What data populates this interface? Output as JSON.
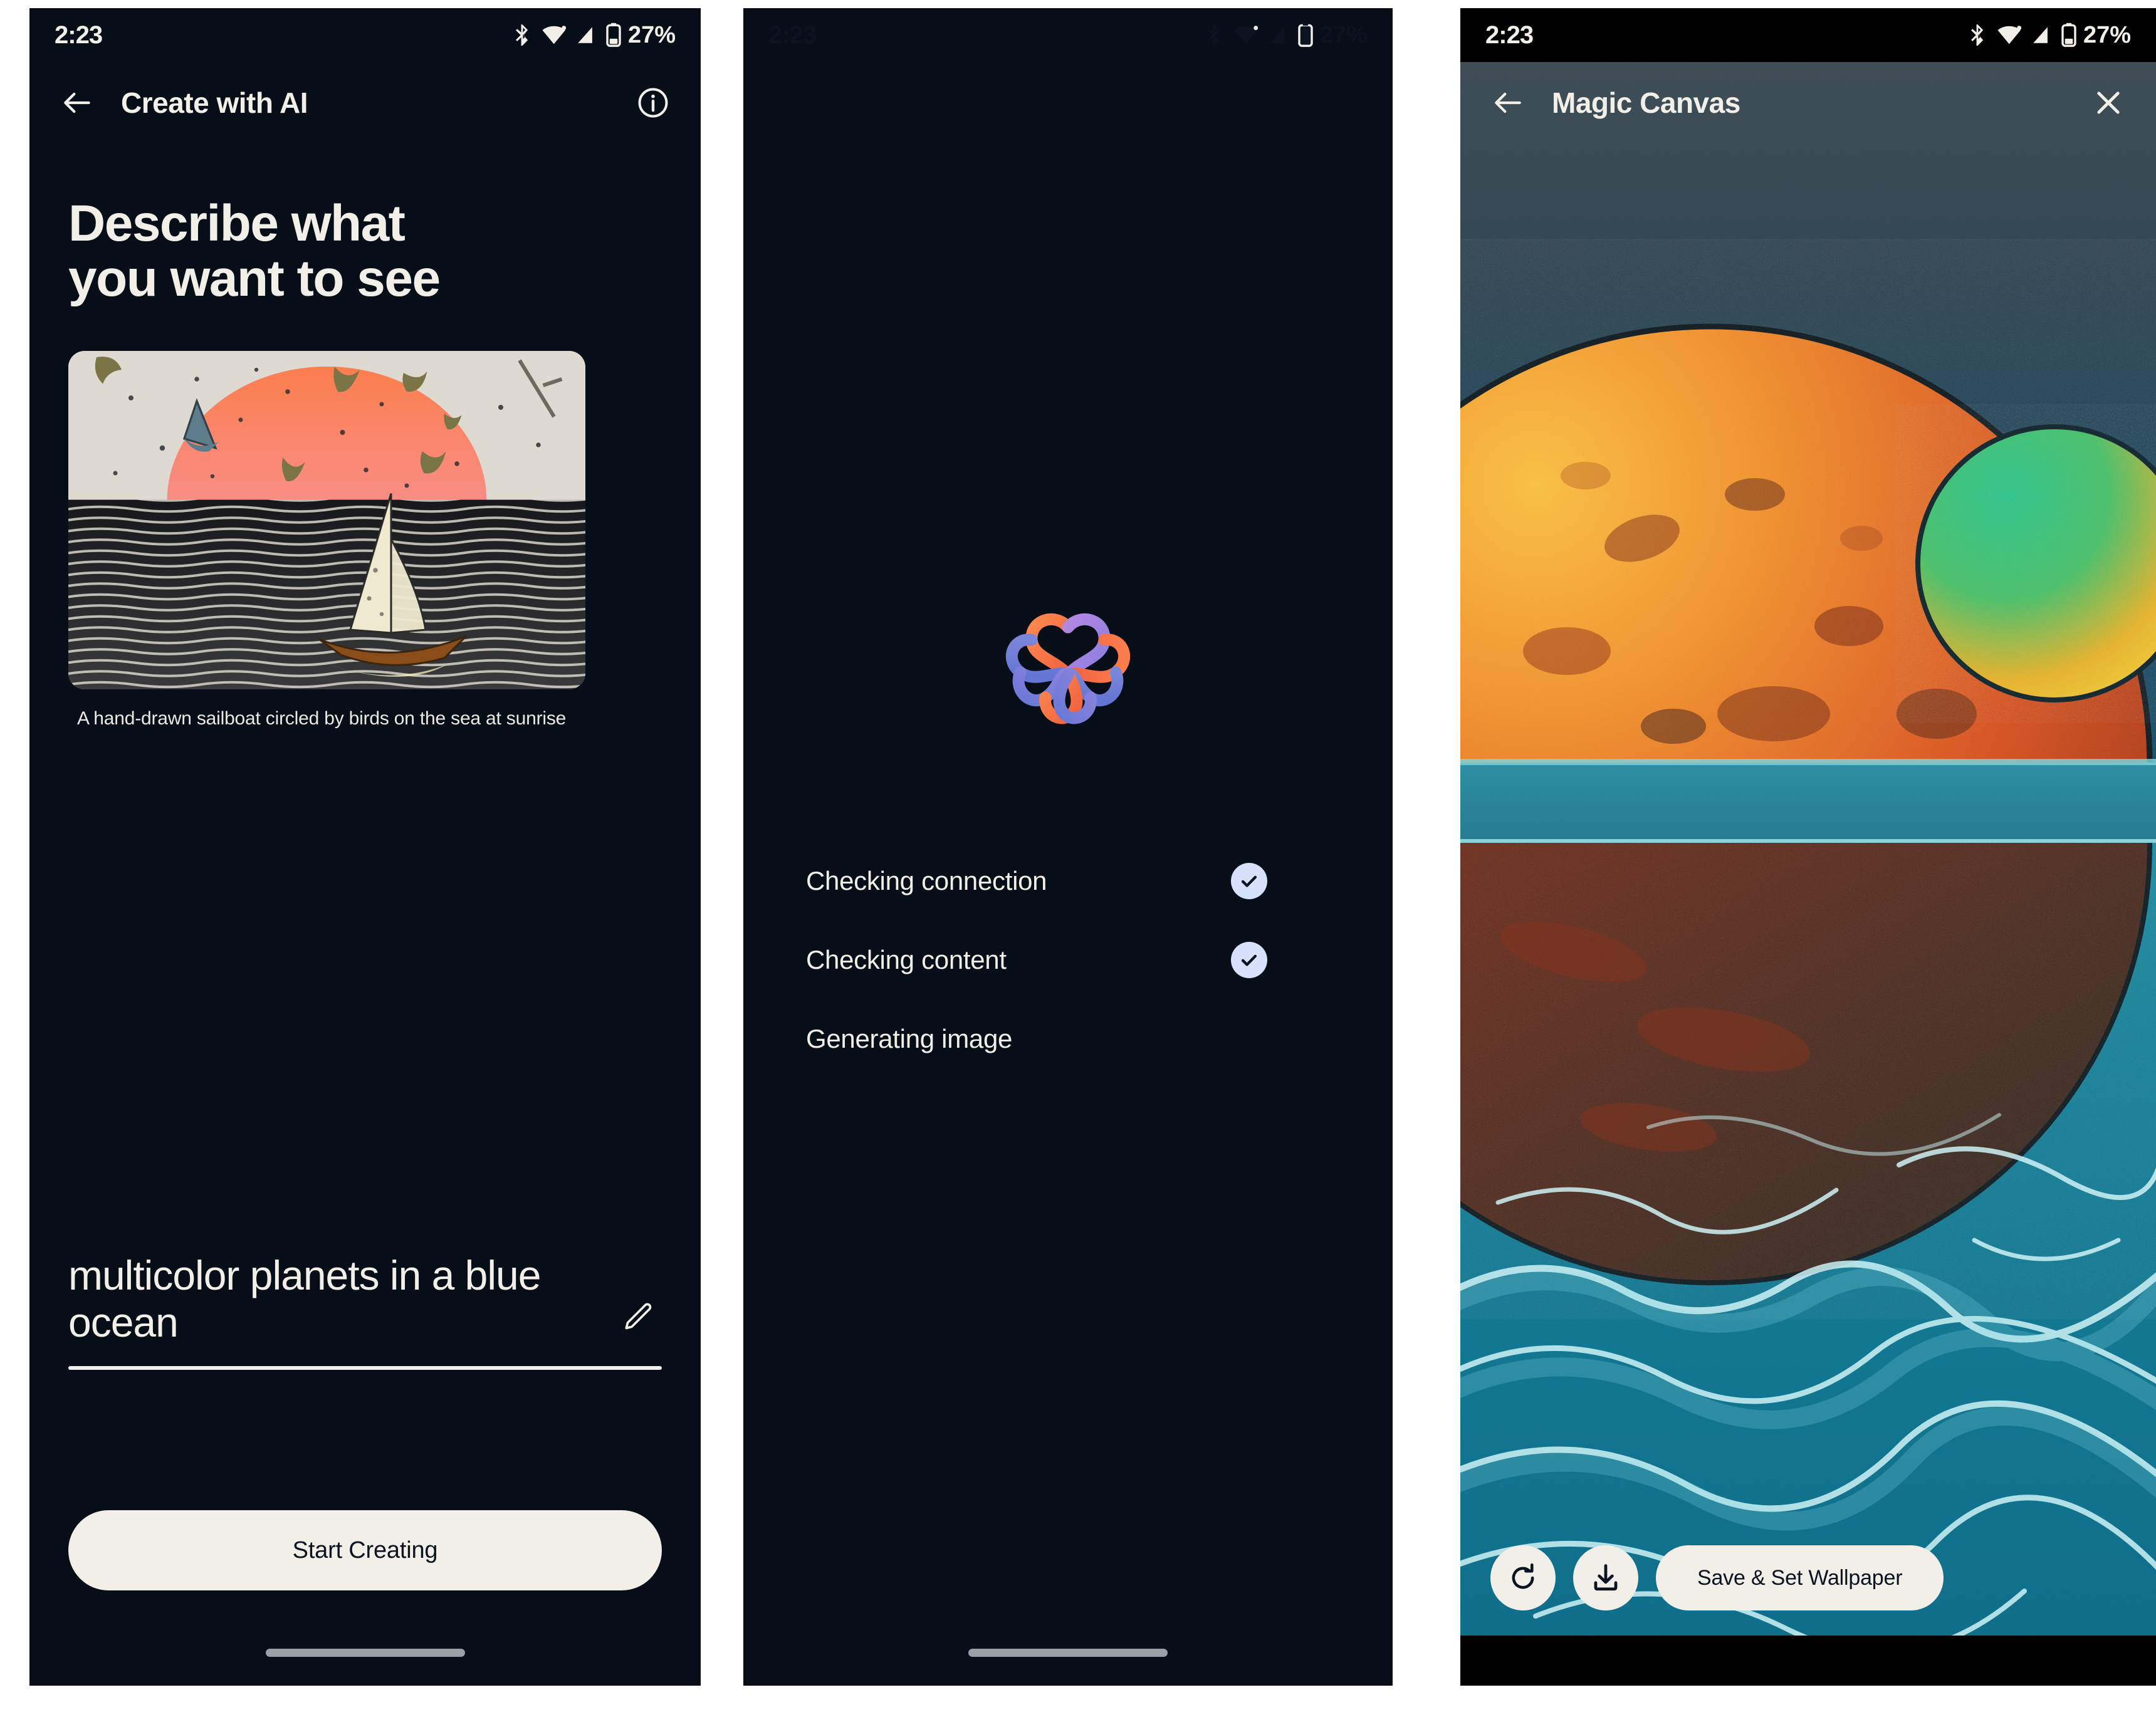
{
  "status_bar": {
    "time": "2:23",
    "battery": "27%",
    "icons": [
      "bluetooth-icon",
      "wifi-icon",
      "cellular-signal-icon",
      "battery-icon"
    ]
  },
  "panel1": {
    "app_bar": {
      "back_label": "back-arrow-icon",
      "title": "Create with AI",
      "info_label": "info-icon"
    },
    "headline_line1": "Describe what",
    "headline_line2": "you want to see",
    "example_caption": "A hand-drawn sailboat circled by birds on the sea at sunrise",
    "prompt_value": "multicolor planets in a blue ocean",
    "edit_icon": "pencil-icon",
    "cta_label": "Start Creating"
  },
  "panel2": {
    "logo": "magic-canvas-knot-logo",
    "steps": [
      {
        "label": "Checking connection",
        "done": true
      },
      {
        "label": "Checking content",
        "done": true
      },
      {
        "label": "Generating image",
        "done": false
      }
    ]
  },
  "panel3": {
    "app_bar": {
      "back_label": "back-arrow-icon",
      "title": "Magic Canvas",
      "close_label": "close-icon"
    },
    "actions": {
      "regenerate_icon": "refresh-icon",
      "download_icon": "download-icon",
      "save_label": "Save & Set Wallpaper"
    }
  },
  "colors": {
    "panel_background": "#070e18",
    "on_surface": "#f2efe9",
    "accent_check": "#d6e2fb",
    "logo_orange": "#f97c4a",
    "logo_purple": "#a97fd6",
    "logo_blue": "#6b79d6",
    "logo_red": "#f2603f",
    "nav_pill": "#9aa0a6"
  }
}
